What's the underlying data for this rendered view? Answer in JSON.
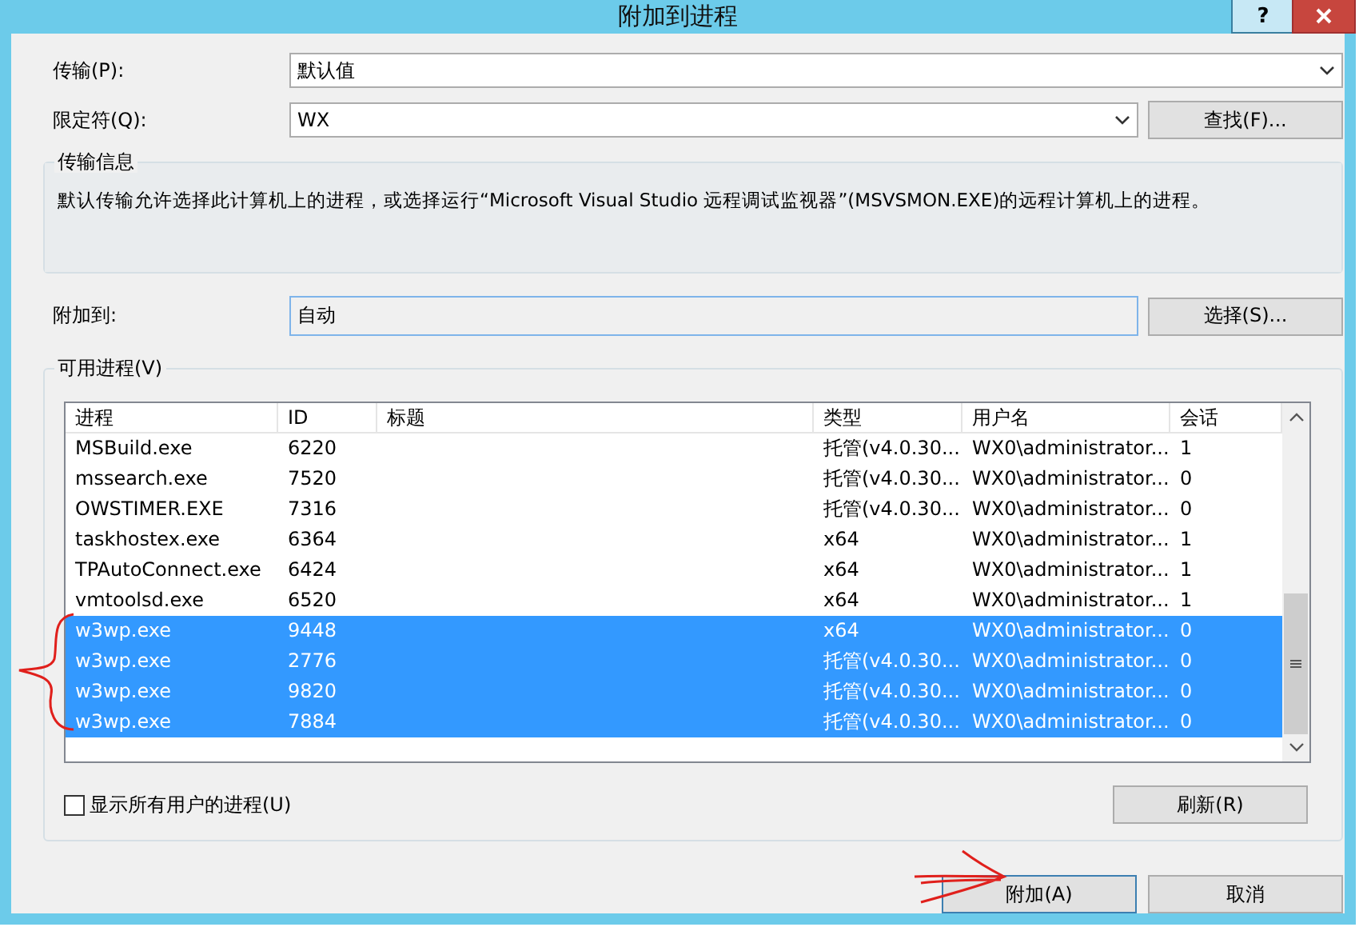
{
  "window": {
    "title": "附加到进程",
    "help_label": "?"
  },
  "transport": {
    "label": "传输(P):",
    "value": "默认值"
  },
  "qualifier": {
    "label": "限定符(Q):",
    "value": "WX",
    "button": "查找(F)..."
  },
  "transport_info": {
    "legend": "传输信息",
    "text": "默认传输允许选择此计算机上的进程，或选择运行“Microsoft Visual Studio 远程调试监视器”(MSVSMON.EXE)的远程计算机上的进程。"
  },
  "attach_to": {
    "label": "附加到:",
    "value": "自动",
    "button": "选择(S)..."
  },
  "processes": {
    "legend": "可用进程(V)",
    "columns": [
      "进程",
      "ID",
      "标题",
      "类型",
      "用户名",
      "会话"
    ],
    "rows": [
      {
        "cells": [
          "MSBuild.exe",
          "6220",
          "",
          "托管(v4.0.30...",
          "WX0\\administrator...",
          "1"
        ],
        "selected": false
      },
      {
        "cells": [
          "mssearch.exe",
          "7520",
          "",
          "托管(v4.0.30...",
          "WX0\\administrator...",
          "0"
        ],
        "selected": false
      },
      {
        "cells": [
          "OWSTIMER.EXE",
          "7316",
          "",
          "托管(v4.0.30...",
          "WX0\\administrator...",
          "0"
        ],
        "selected": false
      },
      {
        "cells": [
          "taskhostex.exe",
          "6364",
          "",
          "x64",
          "WX0\\administrator...",
          "1"
        ],
        "selected": false
      },
      {
        "cells": [
          "TPAutoConnect.exe",
          "6424",
          "",
          "x64",
          "WX0\\administrator...",
          "1"
        ],
        "selected": false
      },
      {
        "cells": [
          "vmtoolsd.exe",
          "6520",
          "",
          "x64",
          "WX0\\administrator...",
          "1"
        ],
        "selected": false
      },
      {
        "cells": [
          "w3wp.exe",
          "9448",
          "",
          "x64",
          "WX0\\administrator...",
          "0"
        ],
        "selected": true
      },
      {
        "cells": [
          "w3wp.exe",
          "2776",
          "",
          "托管(v4.0.30...",
          "WX0\\administrator...",
          "0"
        ],
        "selected": true
      },
      {
        "cells": [
          "w3wp.exe",
          "9820",
          "",
          "托管(v4.0.30...",
          "WX0\\administrator...",
          "0"
        ],
        "selected": true
      },
      {
        "cells": [
          "w3wp.exe",
          "7884",
          "",
          "托管(v4.0.30...",
          "WX0\\administrator...",
          "0"
        ],
        "selected": true
      }
    ],
    "show_all_users": {
      "label": "显示所有用户的进程(U)",
      "checked": false
    },
    "refresh_button": "刷新(R)"
  },
  "buttons": [
    {
      "label": "附加(A)",
      "kind": "default"
    },
    {
      "label": "取消",
      "kind": "normal"
    }
  ]
}
